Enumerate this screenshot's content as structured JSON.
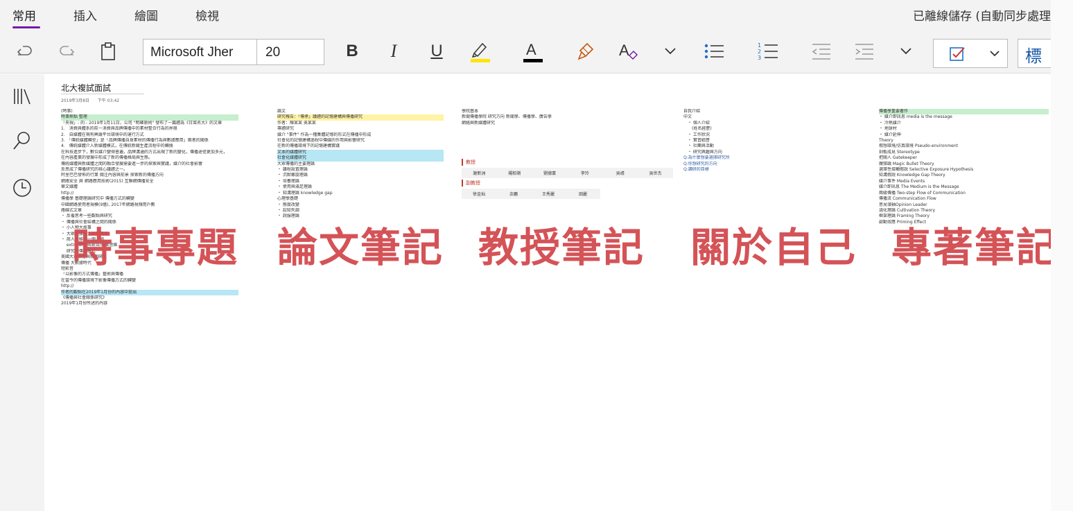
{
  "tabs": [
    {
      "label": "常用",
      "active": true
    },
    {
      "label": "插入",
      "active": false
    },
    {
      "label": "繪圖",
      "active": false
    },
    {
      "label": "檢視",
      "active": false
    }
  ],
  "sync_status": "已離線儲存 (自動同步處理",
  "ribbon": {
    "font_name": "Microsoft Jher",
    "font_size": "20",
    "bold": "B",
    "italic": "I",
    "underline": "U",
    "font_color": "A",
    "clear_format": "A",
    "style_label": "標",
    "highlight_color": "#ffe500",
    "font_color_value": "#000000"
  },
  "page": {
    "title": "北大複試面試",
    "date": "2019年3月8日　　下午 03:42"
  },
  "columns": [
    {
      "lines": [
        "(時事)",
        "時事熱點 整理",
        "「央視」- 的 - 2019年1月11日，公司 \"明確原則\" 發布了一篇題為《甘菜名大》的文章",
        "1.　消費與體系的前一消費與品牌傳播中的素材整合行為的界限",
        "2.　自媒體在現有輿論平台環境中的運行方式",
        "3.　「傳統媒體轉型」是「品牌傳播自身素材的傳播行為與數據應用」兩者的關係",
        "4.　傳統媒體介入新媒體模式，在傳統新聞生產流程中的轉換",
        "",
        "在科技進步下，數位媒介變得普遍，品牌溝通的方式出現了新的變化，傳播途徑更加多元，",
        "在內容產業的發展中形成了新的傳播格局與生態。",
        "傳統媒體與新媒體之間的融合發展需要進一步的探索與實踐，媒介的社會影響",
        "反思成了傳播研究的核心議題之一。",
        "",
        "阿里巴巴發佈的行業 關注內容與前景 探索新的傳播方向",
        "網路安全 與 網路應用技術(2015) 互聯網傳播安全",
        "",
        "",
        "",
        "",
        "華文媒體",
        "http://",
        "傳播學 基礎理論研究中 傳播方式的轉變",
        "",
        "",
        "",
        "",
        "",
        "",
        "",
        "",
        "",
        "",
        "",
        "",
        "",
        "中國網路使用者規模(9億), 2017年網路視頻用戶數",
        "",
        "路線式文章",
        "・ 反覆思考一些觀點與研究",
        "・ 傳播與社會結構之間的關係",
        "・ 小人物大故事",
        "・ 大眾數據與大眾的傳播",
        "・ 商人思維的一個人物",
        "　 extra 研究與政治/商業思維",
        "　 研究的傳播模式",
        "",
        "美國大眾媒體與新聞研究",
        "傳播 大數據時代",
        "",
        "",
        "短影音",
        "「以影像的方式傳播」藝術與傳播",
        "在當今的傳播環境下影像傳播方式的轉變",
        "http://",
        "作者的觀點在2019年1月份的內容中提出",
        "",
        "",
        "《傳播與社會關係研究》",
        "2019年1月份所述的內容"
      ]
    },
    {
      "lines": [
        "論文",
        "",
        "研究報告：「傳承」議題的記憶建構與傳播研究",
        "作者：陳某某 吳某某",
        "",
        "專題研究",
        "媒介 \"事件\" 作為一種集體記憶的形式在傳播中形成",
        "社會化的記憶建構過程中傳媒的作用與影響研究",
        "",
        "",
        "",
        "",
        "在新的傳播環境下的記憶建構實踐",
        "",
        "",
        "",
        "",
        "",
        "",
        "",
        "",
        "",
        "",
        "",
        "",
        "",
        "",
        "",
        "",
        "",
        "",
        "",
        "",
        "",
        "",
        "文本的媒體研究",
        "",
        "",
        "",
        "社會化媒體研究",
        "",
        "",
        "",
        "",
        "",
        "",
        "",
        "",
        "",
        "",
        "",
        "",
        "",
        "",
        "大眾傳播的主要理論",
        "・ 議程設置理論",
        "・ 沉默螺旋理論",
        "・ 培養理論",
        "・ 使用與滿足理論",
        "・ 知溝理論 knowledge gap",
        "",
        "",
        "心理學基礎",
        "・ 態度改變",
        "・ 認知失調",
        "・ 說服理論"
      ]
    },
    {
      "lines": [
        "學院基本",
        "",
        "新聞傳播學院 研究方向 新聞學、傳播學、廣告學",
        "網絡與新媒體研究",
        "",
        "",
        "",
        "",
        "",
        "",
        "",
        "",
        "",
        "",
        "",
        "",
        "",
        "",
        "",
        "",
        "",
        "",
        "",
        "",
        "",
        "",
        "",
        "",
        "",
        "",
        "",
        "",
        "",
        "",
        "",
        "",
        "",
        "",
        "",
        "",
        "",
        "",
        "",
        "",
        "",
        "",
        "",
        "",
        "",
        "",
        "",
        "",
        "",
        "",
        "",
        "",
        "",
        "",
        "",
        "",
        "",
        "",
        "",
        "",
        ""
      ]
    },
    {
      "lines": [
        "自我介紹",
        "",
        "中文",
        "　・ 個人介紹",
        "　　(姓名經歷)",
        "　・ 工作狀況",
        "　・ 實習經歷",
        "　・ 社團與活動",
        "　・ 研究興趣與方向",
        "",
        "",
        "",
        "",
        "",
        "",
        "",
        "",
        "",
        "",
        "",
        "",
        "",
        "",
        "",
        "",
        "Q:為什麼想要選擇研究所",
        "",
        "",
        "",
        "",
        "",
        "",
        "",
        "",
        "",
        "",
        "",
        "",
        "",
        "",
        "",
        "Q:你想研究的方向",
        "",
        "",
        "",
        "",
        "",
        "",
        "",
        "",
        "",
        "",
        "",
        "",
        "",
        "",
        "",
        "",
        "",
        "",
        "",
        "",
        "",
        "Q:讀研的目標",
        "",
        ""
      ]
    },
    {
      "lines": [
        "傳播學重要著作",
        "・ 媒介即訊息 media is the message",
        "・ 冷熱媒介",
        "・ 地球村",
        "・ 媒介延伸",
        "",
        "",
        "",
        "",
        "",
        "",
        "",
        "",
        "",
        "",
        "",
        "",
        "",
        "",
        "",
        "",
        "",
        "",
        "",
        "",
        "",
        "",
        "",
        "",
        "",
        "",
        "",
        "",
        "",
        "",
        "",
        "",
        "",
        "",
        "",
        "",
        "",
        "",
        "",
        "",
        "",
        "",
        "",
        "",
        "",
        "",
        "",
        "",
        "",
        "",
        "",
        "Theory",
        "假想環境/仿真環境 Pseudo-environment",
        "刻板成見 Stereotype",
        "把關人 Gatekeeper",
        "魔彈論 Magic Bullet Theory",
        "選擇性接觸假說 Selective Exposure Hypothesis",
        "知溝假說 Knowledge Gap Theory",
        "媒介事件 Media Events",
        "媒介即訊息 The Medium is the Message",
        "兩級傳播 Two-step Flow of Communication",
        "傳播流 Communication Flow",
        "意見領袖Opinion Leader",
        "涵化理論 Cultivation Theory",
        "框架理論 Framing Theory",
        "啟動效應 Priming Effect"
      ]
    }
  ],
  "professors": {
    "header_1": "教授",
    "row_1": [
      "謝新洲",
      "楊柏嶺",
      "劉德寰",
      "李玲",
      "吳靖",
      "吳世杰"
    ],
    "header_2": "副教授",
    "row_2": [
      "徐金灿",
      "余鵬",
      "王秀麗",
      "田麗"
    ]
  },
  "overlays": [
    "時事專題",
    "論文筆記",
    "教授筆記",
    "關於自己",
    "專著筆記"
  ],
  "overlay_color": "#d24a4f",
  "accent_color": "#7719aa"
}
